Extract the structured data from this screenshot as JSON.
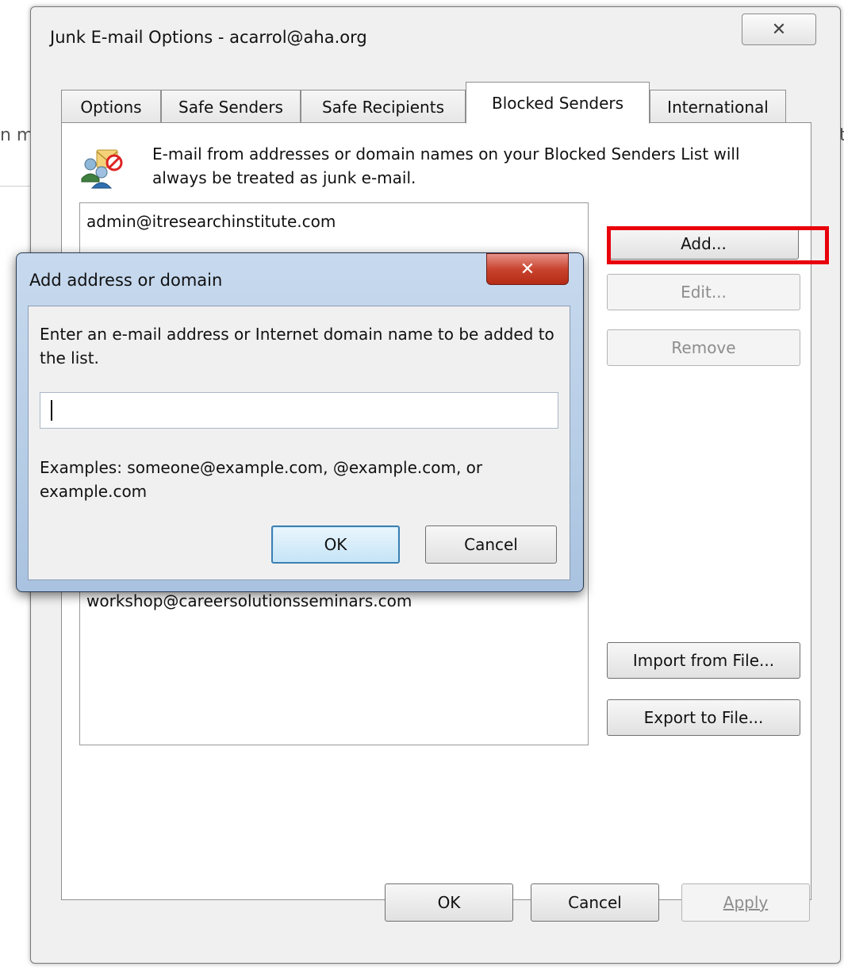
{
  "background": {
    "left_fragment": "n m",
    "right_fragment": "t"
  },
  "main_dialog": {
    "title": "Junk E-mail Options - acarrol@aha.org",
    "close_glyph": "✕",
    "tabs": [
      {
        "label": "Options",
        "active": false
      },
      {
        "label": "Safe Senders",
        "active": false
      },
      {
        "label": "Safe Recipients",
        "active": false
      },
      {
        "label": "Blocked Senders",
        "active": true
      },
      {
        "label": "International",
        "active": false
      }
    ],
    "description": "E-mail from addresses or domain names on your Blocked Senders List will always be treated as junk e-mail.",
    "icon": "blocked-senders-icon",
    "blocked_senders": [
      "admin@itresearchinstitute.com",
      "workshop@careersolutionsseminars.com"
    ],
    "buttons": {
      "add": "Add...",
      "edit": "Edit...",
      "remove": "Remove",
      "import": "Import from File...",
      "export": "Export to File...",
      "ok": "OK",
      "cancel": "Cancel",
      "apply": "Apply"
    },
    "highlight_color": "#e8000b"
  },
  "add_dialog": {
    "title": "Add address or domain",
    "close_glyph": "✕",
    "prompt": "Enter an e-mail address or Internet domain name to be added to the list.",
    "input_value": "",
    "examples": "Examples: someone@example.com, @example.com, or example.com",
    "buttons": {
      "ok": "OK",
      "cancel": "Cancel"
    }
  }
}
